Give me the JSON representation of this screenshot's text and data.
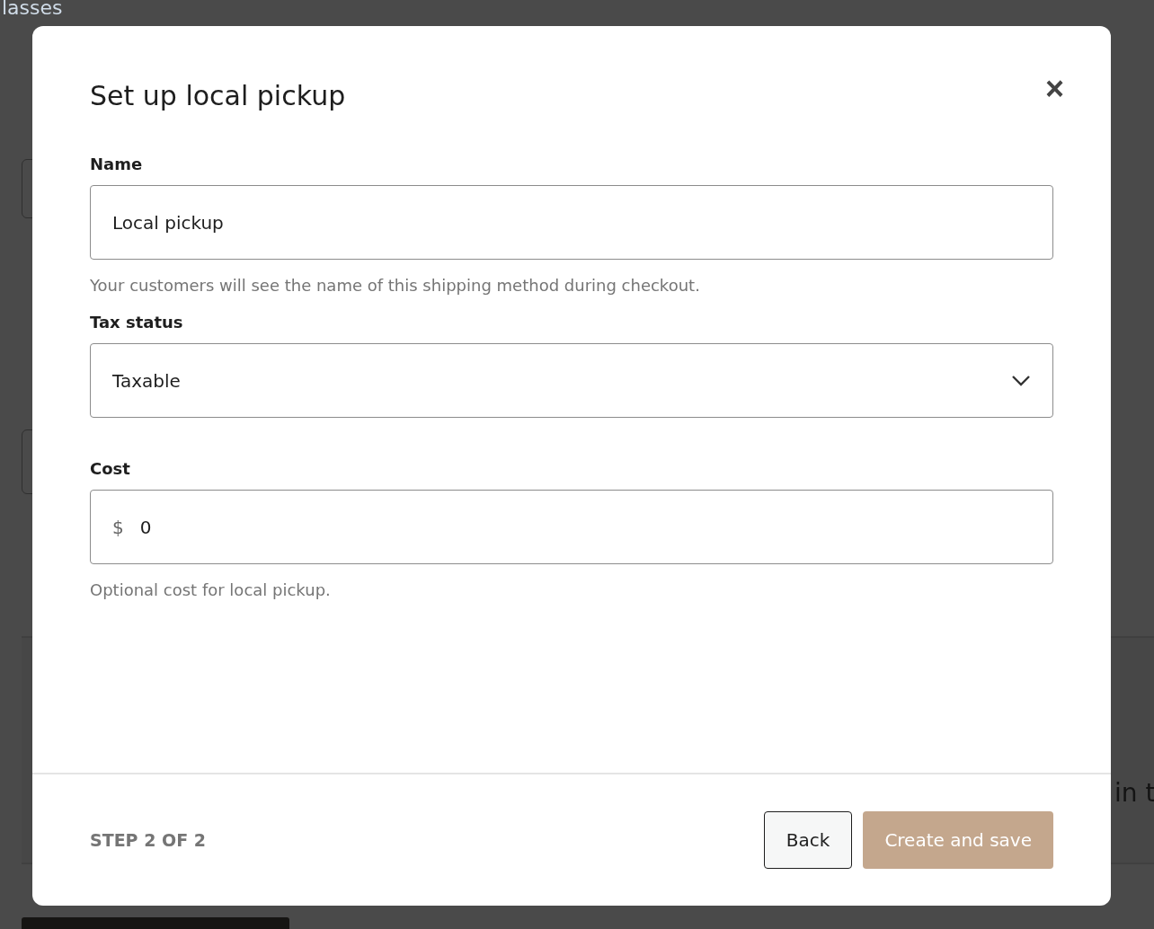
{
  "background": {
    "heading": "lasses",
    "fragment": "in t"
  },
  "dialog": {
    "title": "Set up local pickup",
    "close": "×",
    "fields": [
      {
        "kind": "text",
        "label": "Name",
        "value": "Local pickup",
        "help": "Your customers will see the name of this shipping method during checkout."
      },
      {
        "kind": "select",
        "label": "Tax status",
        "value": "Taxable"
      },
      {
        "kind": "money",
        "label": "Cost",
        "prefix": "$",
        "value": "0",
        "help": "Optional cost for local pickup."
      }
    ],
    "step": "STEP 2 OF 2",
    "buttons": [
      {
        "label": "Back",
        "kind": "secondary",
        "disabled": false
      },
      {
        "label": "Create and save",
        "kind": "primary",
        "disabled": true
      }
    ]
  }
}
